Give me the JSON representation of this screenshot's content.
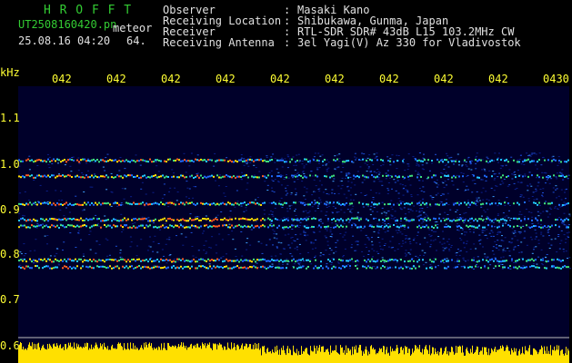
{
  "header": {
    "brand": "H R O F F T",
    "filename": "UT2508160420.pn",
    "meteor_label": "meteor",
    "datetime": "25.08.16 04:20",
    "count": "64.",
    "fields": [
      {
        "label": "Observer",
        "sep": ":",
        "value": "Masaki Kano"
      },
      {
        "label": "Receiving Location",
        "sep": ":",
        "value": "Shibukawa, Gunma, Japan"
      },
      {
        "label": "Receiver",
        "sep": ":",
        "value": "RTL-SDR SDR# 43dB L15 103.2MHz CW"
      },
      {
        "label": "Receiving Antenna",
        "sep": ":",
        "value": "3el Yagi(V) Az 330 for Vladivostok"
      }
    ]
  },
  "axis": {
    "unit": "kHz",
    "time_ticks": [
      "042",
      "042",
      "042",
      "042",
      "042",
      "042",
      "042",
      "042",
      "042",
      "0430"
    ],
    "freq_ticks": [
      "1.1",
      "1.0",
      "0.9",
      "0.8",
      "0.7",
      "0.6"
    ]
  },
  "colors": {
    "header_green": "#33cc33",
    "text_white": "#e0e0e0",
    "axis_yellow": "#ffff33",
    "background": "#000000",
    "plot_background": "#00002a",
    "echo_band": "#ffe000"
  },
  "spectrogram": {
    "bands_khz": [
      1.01,
      0.975,
      0.915,
      0.88,
      0.865,
      0.79,
      0.775
    ],
    "noise_level": "strong after 0425"
  }
}
